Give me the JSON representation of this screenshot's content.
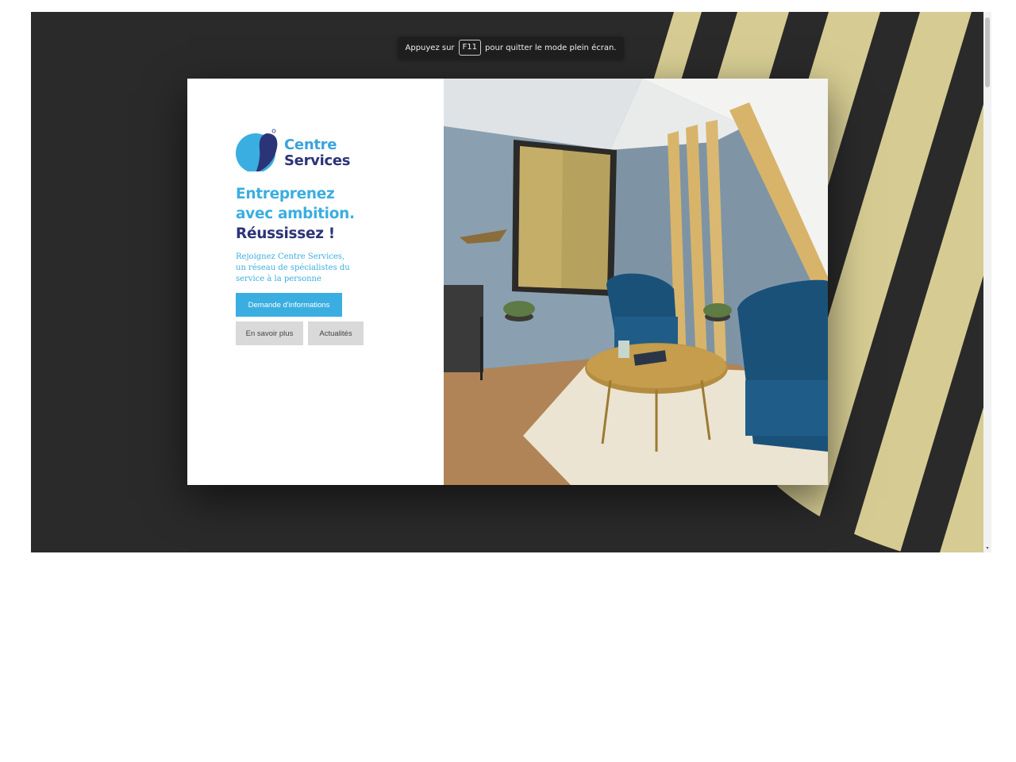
{
  "fullscreen_notice": {
    "before": "Appuyez sur",
    "key": "F11",
    "after": "pour quitter le mode plein écran."
  },
  "brand": {
    "line1": "Centre",
    "line2": "Services"
  },
  "headline": {
    "line1": "Entreprenez",
    "line2": "avec ambition.",
    "line3": "Réussissez !"
  },
  "tagline": {
    "line1": "Rejoignez Centre Services,",
    "line2": "un réseau de spécialistes du",
    "line3": "service à la personne"
  },
  "buttons": {
    "info": "Demande d'informations",
    "more": "En savoir plus",
    "news": "Actualités"
  },
  "colors": {
    "accent_blue": "#3aaee0",
    "dark_blue": "#2c3478",
    "stripe_gold": "#d6cc93",
    "background_dark": "#2a2a2a"
  }
}
